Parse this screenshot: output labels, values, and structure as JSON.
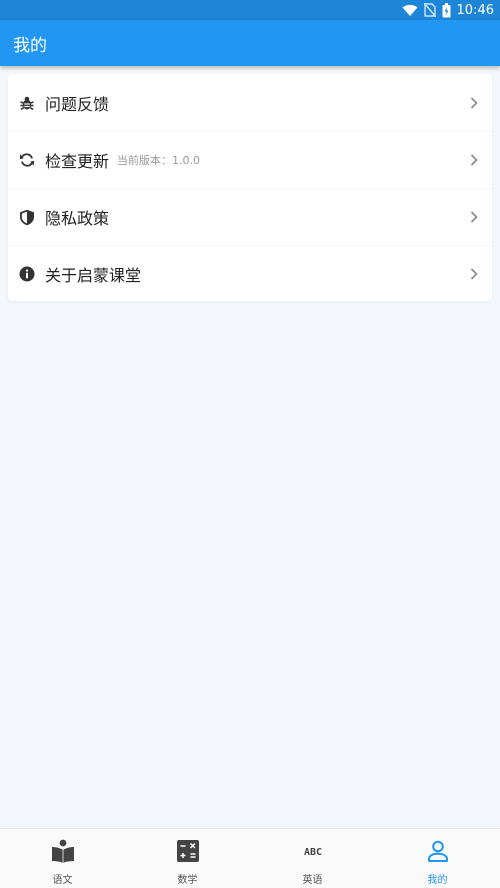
{
  "status_bar": {
    "time": "10:46"
  },
  "app_bar": {
    "title": "我的"
  },
  "menu": {
    "items": [
      {
        "icon": "bug-icon",
        "label": "问题反馈"
      },
      {
        "icon": "refresh-icon",
        "label": "检查更新",
        "sub": "当前版本：1.0.0"
      },
      {
        "icon": "shield-icon",
        "label": "隐私政策"
      },
      {
        "icon": "info-icon",
        "label": "关于启蒙课堂"
      }
    ]
  },
  "bottom_nav": {
    "items": [
      {
        "icon": "book-reader-icon",
        "label": "语文"
      },
      {
        "icon": "calculator-icon",
        "label": "数学"
      },
      {
        "icon": "abc-icon",
        "label": "英语",
        "glyph": "ABC"
      },
      {
        "icon": "person-icon",
        "label": "我的",
        "active": true
      }
    ]
  },
  "colors": {
    "primary": "#2196f3",
    "status_bar": "#1d86d8",
    "background": "#f3f7fb",
    "text": "#222222",
    "muted": "#9a9a9a",
    "icon_dark": "#333333"
  }
}
